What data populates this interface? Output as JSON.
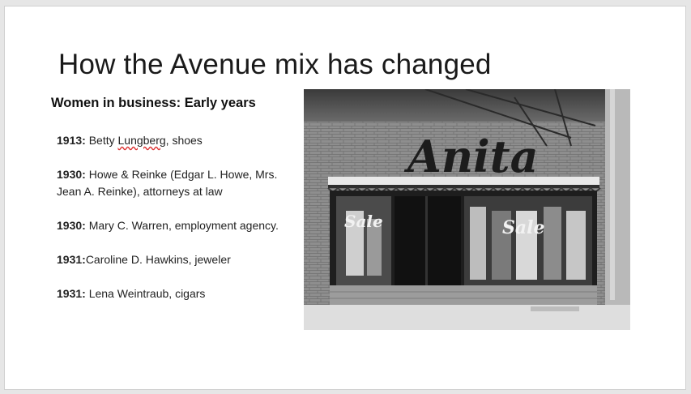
{
  "slide": {
    "title": "How the Avenue mix has changed",
    "subtitle": "Women in business:  Early years",
    "entries": [
      {
        "year": "1913:",
        "pre": " Betty ",
        "underlined": "Lungberg",
        "post": ", shoes"
      },
      {
        "year": "1930:",
        "text": " Howe &   Reinke (Edgar L. Howe, Mrs. Jean A. Reinke), attorneys at law"
      },
      {
        "year": "1930:",
        "text": " Mary C. Warren, employment agency."
      },
      {
        "year": "1931:",
        "text": "Caroline D. Hawkins, jeweler"
      },
      {
        "year": "1931:",
        "text": " Lena Weintraub, cigars"
      }
    ]
  },
  "photo": {
    "sign_text": "Anita",
    "window_sign_left": "Sale",
    "window_sign_right": "Sale"
  }
}
